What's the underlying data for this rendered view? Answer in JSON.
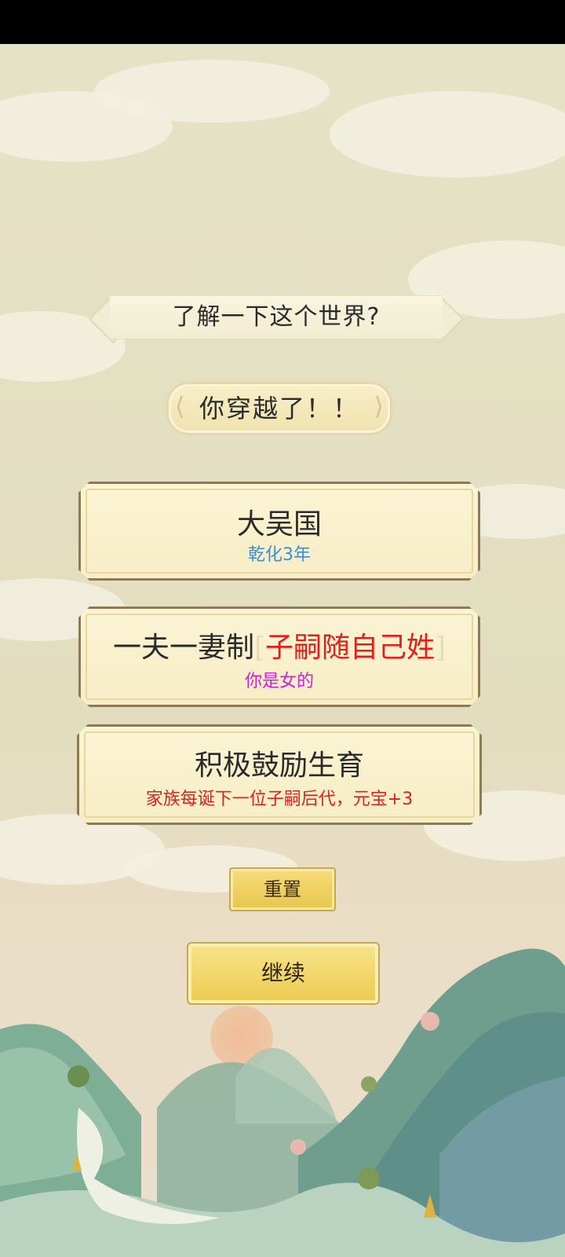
{
  "title": "了解一下这个世界?",
  "subtitle": "你穿越了！！",
  "cards": [
    {
      "main": "大吴国",
      "sub": "乾化3年",
      "sub_color": "#3b8fd6"
    },
    {
      "main_prefix": "一夫一妻制",
      "bracket_open": "[",
      "main_highlight": "子嗣随自己姓",
      "bracket_close": "]",
      "sub": "你是女的",
      "sub_color": "#d21fd6",
      "highlight_color": "#e1201c"
    },
    {
      "main": "积极鼓励生育",
      "sub": "家族每诞下一位子嗣后代，元宝+3",
      "sub_color": "#d6261f"
    }
  ],
  "buttons": {
    "reset": "重置",
    "continue": "继续"
  },
  "colors": {
    "button_gold": "#ecca50",
    "card_bg": "#f7edc6",
    "card_border": "#8b7a52"
  }
}
